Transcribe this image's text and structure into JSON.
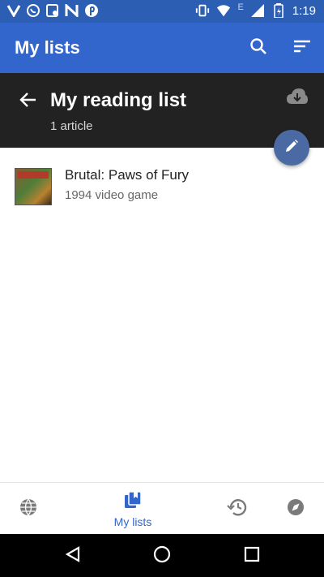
{
  "status_bar": {
    "time": "1:19",
    "left_icons": [
      "vpn-v-icon",
      "whatsapp-icon",
      "message-icon",
      "news-icon",
      "pinterest-icon"
    ],
    "right_icons": [
      "vibrate-icon",
      "wifi-icon",
      "signal-icon",
      "battery-icon"
    ],
    "network_type": "E"
  },
  "app_bar": {
    "title": "My lists",
    "color": "#3366cc"
  },
  "list_header": {
    "title": "My reading list",
    "count": "1 article"
  },
  "articles": [
    {
      "title": "Brutal: Paws of Fury",
      "description": "1994 video game"
    }
  ],
  "bottom_nav": {
    "items": [
      {
        "icon": "globe-icon",
        "label": ""
      },
      {
        "icon": "reading-lists-icon",
        "label": "My lists",
        "active": true
      },
      {
        "icon": "history-icon",
        "label": ""
      },
      {
        "icon": "compass-icon",
        "label": ""
      }
    ],
    "active_color": "#3366cc"
  }
}
